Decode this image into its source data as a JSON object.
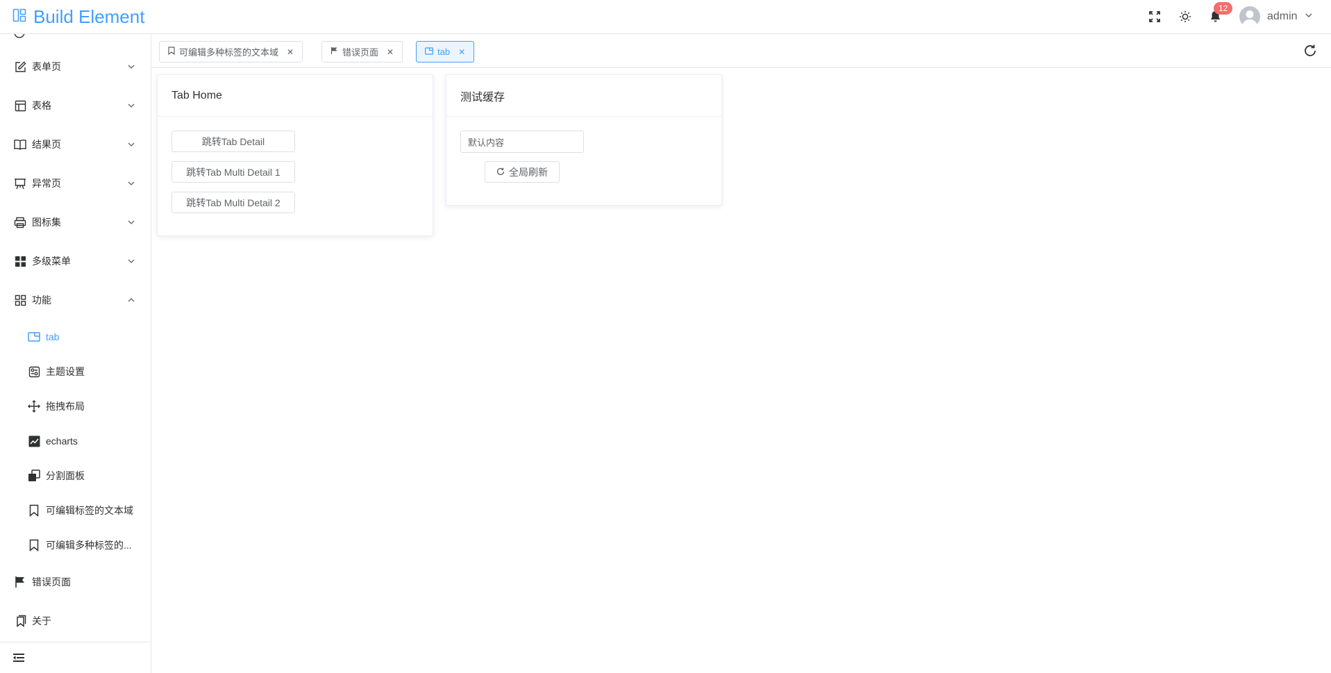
{
  "header": {
    "title": "Build Element",
    "notification_count": "12",
    "user_name": "admin"
  },
  "sidebar": {
    "menus": [
      {
        "label": "表单页",
        "icon": "edit-icon"
      },
      {
        "label": "表格",
        "icon": "table-icon"
      },
      {
        "label": "结果页",
        "icon": "book-icon"
      },
      {
        "label": "异常页",
        "icon": "easel-icon"
      },
      {
        "label": "图标集",
        "icon": "printer-icon"
      },
      {
        "label": "多级菜单",
        "icon": "grid-icon"
      },
      {
        "label": "功能",
        "icon": "apps-icon"
      }
    ],
    "submenus": [
      {
        "label": "tab",
        "icon": "window-icon"
      },
      {
        "label": "主题设置",
        "icon": "theme-icon"
      },
      {
        "label": "拖拽布局",
        "icon": "move-icon"
      },
      {
        "label": "echarts",
        "icon": "chart-icon"
      },
      {
        "label": "分割面板",
        "icon": "copy-icon"
      },
      {
        "label": "可编辑标签的文本域",
        "icon": "bookmark-icon"
      },
      {
        "label": "可编辑多种标签的...",
        "icon": "bookmark-icon"
      }
    ],
    "bottom_items": [
      {
        "label": "错误页面",
        "icon": "flag-icon"
      },
      {
        "label": "关于",
        "icon": "bookmarks-icon"
      }
    ]
  },
  "tabs": [
    {
      "label": "可编辑多种标签的文本域",
      "icon": "bookmark-icon"
    },
    {
      "label": "错误页面",
      "icon": "flag-icon"
    },
    {
      "label": "tab",
      "icon": "window-icon"
    }
  ],
  "cards": {
    "home": {
      "title": "Tab Home",
      "buttons": [
        "跳转Tab Detail",
        "跳转Tab Multi Detail 1",
        "跳转Tab Multi Detail 2"
      ]
    },
    "cache": {
      "title": "测试缓存",
      "input_value": "默认内容",
      "refresh_label": "全局刷新"
    }
  },
  "colors": {
    "accent": "#409eff",
    "badge": "#f56c6c",
    "text": "#303133"
  }
}
